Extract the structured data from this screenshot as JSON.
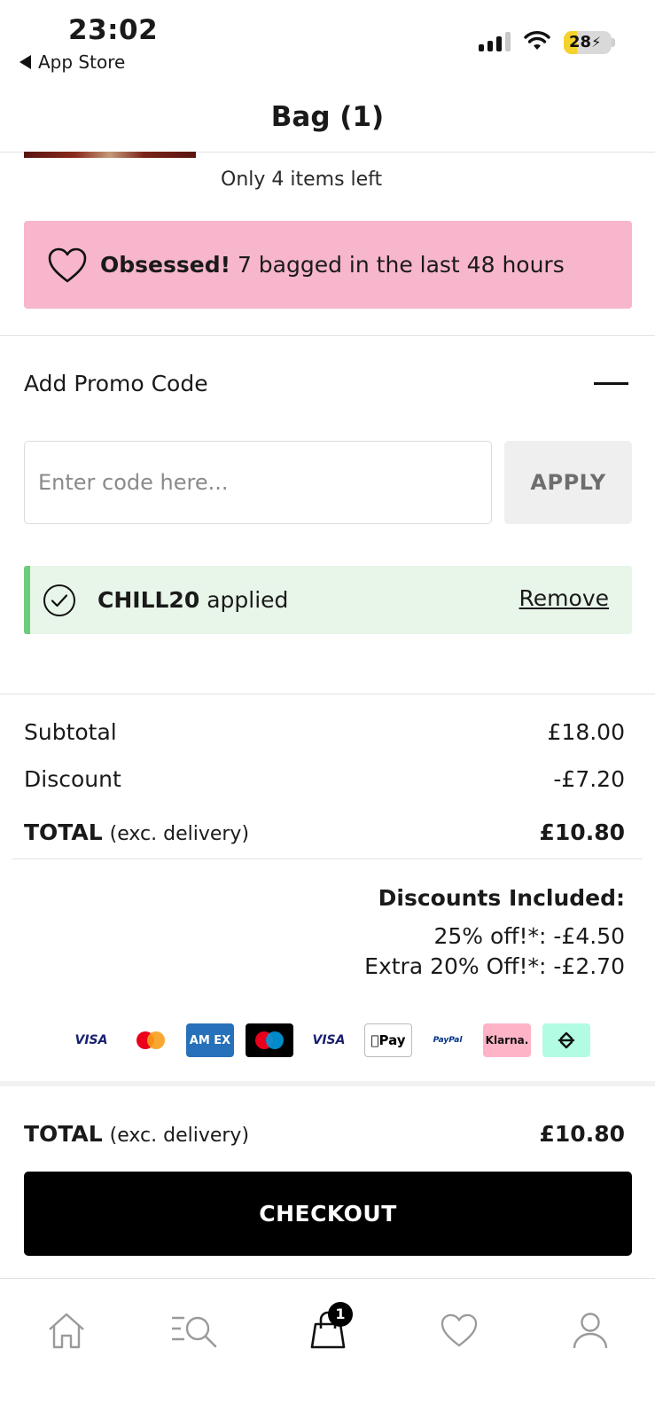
{
  "status_bar": {
    "time": "23:02",
    "back_label": "App Store",
    "battery_percent": "28",
    "battery_level": 0.28
  },
  "header": {
    "title": "Bag (1)"
  },
  "product": {
    "stock_note": "Only 4 items left"
  },
  "obsessed_banner": {
    "strong": "Obsessed!",
    "text": "7 bagged in the last 48 hours",
    "color": "#f7b6cb"
  },
  "promo": {
    "title": "Add Promo Code",
    "input_value": "",
    "input_placeholder": "Enter code here...",
    "apply_label": "APPLY",
    "applied_code": "CHILL20",
    "applied_suffix": "applied",
    "remove_label": "Remove",
    "applied_color": "#6ccc7a"
  },
  "summary": {
    "subtotal_label": "Subtotal",
    "subtotal_value": "£18.00",
    "discount_label": "Discount",
    "discount_value": "-£7.20",
    "total_label": "TOTAL",
    "total_note": "(exc. delivery)",
    "total_value": "£10.80"
  },
  "discounts": {
    "heading": "Discounts Included:",
    "lines": [
      "25% off!*: -£4.50",
      "Extra 20% Off!*: -£2.70"
    ]
  },
  "payment_methods": [
    "VISA",
    "Mastercard",
    "American Express",
    "Maestro",
    "Visa Electron",
    "Pay",
    "PayPal",
    "Klarna.",
    "Clearpay"
  ],
  "payment_labels": {
    "visa": "VISA",
    "amex": "AM EX",
    "visa_electron": "VISA",
    "apple_pay": "Pay",
    "paypal": "PayPal",
    "klarna": "Klarna."
  },
  "footer": {
    "total_label": "TOTAL",
    "total_note": "(exc. delivery)",
    "total_value": "£10.80",
    "checkout_label": "CHECKOUT"
  },
  "tab_bar": {
    "items": [
      "home-icon",
      "search-menu-icon",
      "bag-icon",
      "heart-icon",
      "account-icon"
    ],
    "bag_count": "1"
  },
  "colors": {
    "accent": "#000000",
    "banner_pink": "#f7b6cb",
    "success_green": "#6ccc7a",
    "success_bg": "#e8f5e9"
  }
}
